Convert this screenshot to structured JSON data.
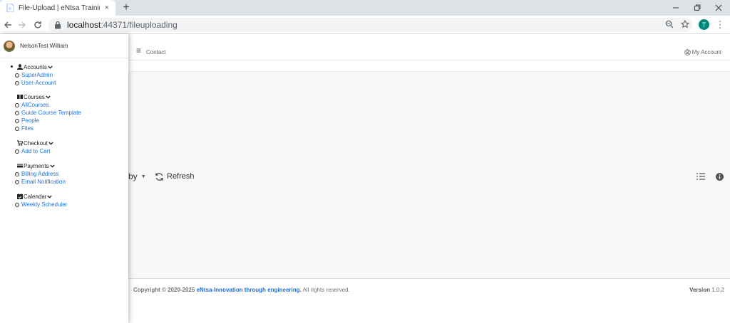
{
  "browser": {
    "tab_title": "File-Upload | eNtsa Training-Aca",
    "tab_close": "×",
    "new_tab": "+",
    "url_host": "localhost",
    "url_path": ":44371/fileuploading",
    "profile_initial": "T",
    "colors": {
      "profile": "#00897b",
      "tabbar": "#dee1e6"
    }
  },
  "sidebar": {
    "user_name": "NelsonTest William",
    "groups": [
      {
        "label": "Accounts",
        "icon": "user-icon",
        "items": [
          "SuperAdmin",
          "User-Account"
        ]
      },
      {
        "label": "Courses",
        "icon": "book-icon",
        "items": [
          "AllCourses",
          "Guide Course Template",
          "People",
          "Files"
        ]
      },
      {
        "label": "Checkout",
        "icon": "cart-icon",
        "items": [
          "Add to Cart"
        ]
      },
      {
        "label": "Payments",
        "icon": "credit-card-icon",
        "items": [
          "Billing Address",
          "Email Notification"
        ]
      },
      {
        "label": "Calendar",
        "icon": "calendar-check-icon",
        "items": [
          "Weekly Scheduler"
        ]
      }
    ]
  },
  "topnav": {
    "contact": "Contact",
    "my_account": "My Account"
  },
  "filemanager": {
    "sort_label": "by",
    "refresh_label": "Refresh"
  },
  "footer": {
    "copyright_prefix": "Copyright © 2020-2025",
    "brand": "eNtsa-Innovation through engineering.",
    "rights": "All rights reserved.",
    "version_label": "Version",
    "version_value": "1.0.2",
    "colors": {
      "brand": "#1e6fd9"
    }
  }
}
